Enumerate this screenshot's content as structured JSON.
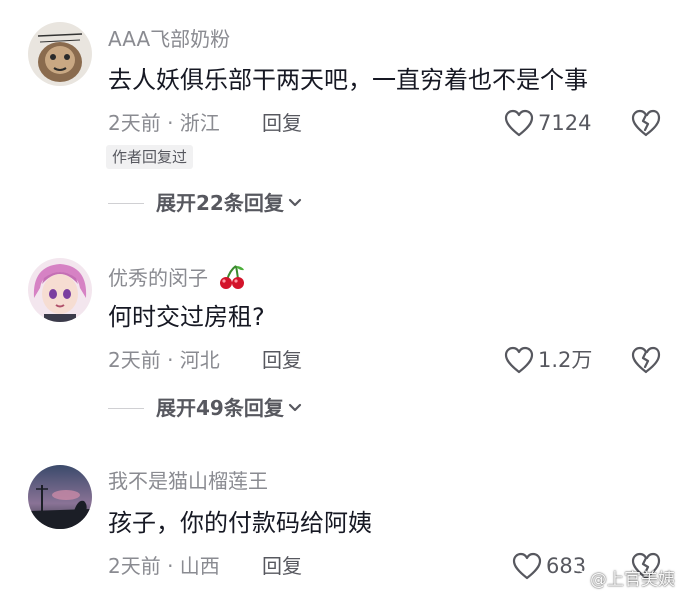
{
  "comments": [
    {
      "username": "AAA飞部奶粉",
      "text": "去人妖俱乐部干两天吧，一直穷着也不是个事",
      "meta": "2天前 · 浙江",
      "reply_label": "回复",
      "likes": "7124",
      "author_tag": "作者回复过",
      "expand_label": "展开22条回复"
    },
    {
      "username": "优秀的闵子",
      "emoji": "cherry-emoji",
      "text": "何时交过房租?",
      "meta": "2天前 · 河北",
      "reply_label": "回复",
      "likes": "1.2万",
      "expand_label": "展开49条回复"
    },
    {
      "username": "我不是猫山榴莲王",
      "text": "孩子，你的付款码给阿姨",
      "meta": "2天前 · 山西",
      "reply_label": "回复",
      "likes": "683"
    }
  ],
  "watermark": {
    "text": "@上官美姨",
    "icon": "weibo-icon"
  },
  "colors": {
    "primary_text": "#161823",
    "secondary_text": "#8a8b91",
    "action_text": "#57585f",
    "tag_bg": "#f1f1f2"
  }
}
